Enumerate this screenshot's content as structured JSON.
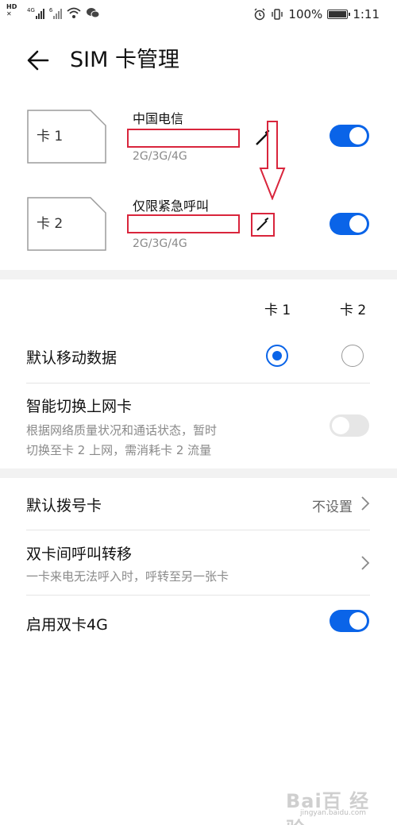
{
  "status_bar": {
    "hd_label": "HD",
    "sig1_label": "4G",
    "sig2_label": "6",
    "battery": "100%",
    "time": "1:11"
  },
  "header": {
    "title": "SIM 卡管理"
  },
  "sim_cards": [
    {
      "label": "卡 1",
      "carrier": "中国电信",
      "network": "2G/3G/4G",
      "enabled": true
    },
    {
      "label": "卡 2",
      "carrier": "仅限紧急呼叫",
      "network": "2G/3G/4G",
      "enabled": true
    }
  ],
  "columns": {
    "card1": "卡 1",
    "card2": "卡 2"
  },
  "settings": {
    "default_data": {
      "title": "默认移动数据",
      "selected": "card1"
    },
    "smart_switch": {
      "title": "智能切换上网卡",
      "subtitle_line1": "根据网络质量状况和通话状态，暂时",
      "subtitle_line2": "切换至卡 2 上网，需消耗卡 2 流量",
      "enabled": false
    },
    "default_dial": {
      "title": "默认拨号卡",
      "value": "不设置"
    },
    "call_forward": {
      "title": "双卡间呼叫转移",
      "subtitle": "一卡来电无法呼入时，呼转至另一张卡"
    },
    "dual_4g": {
      "title": "启用双卡4G",
      "enabled": true
    }
  },
  "colors": {
    "accent": "#0a64e8",
    "annotation": "#d9253c"
  },
  "watermark": {
    "text": "Bai百 经验",
    "url": "jingyan.baidu.com"
  }
}
